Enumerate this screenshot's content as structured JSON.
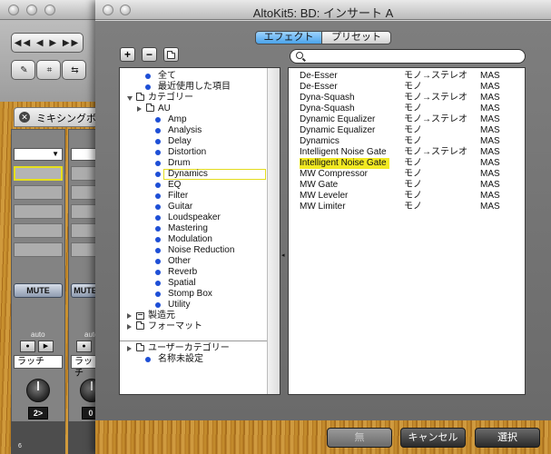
{
  "background_app": {
    "mixer_tab_label": "ミキシングボ",
    "mute_label": "MUTE",
    "auto_label": "auto",
    "latch_label": "ラッチ",
    "pan_left": "2>",
    "pan_right": "0",
    "meter_label": "6"
  },
  "dialog": {
    "title": "AltoKit5: BD: インサート A",
    "tabs": [
      {
        "label": "エフェクト",
        "selected": true
      },
      {
        "label": "プリセット",
        "selected": false
      }
    ],
    "toolbar": {
      "add_symbol": "+",
      "remove_symbol": "−"
    },
    "search": {
      "placeholder": "",
      "value": ""
    }
  },
  "category_tree": [
    {
      "label": "全て",
      "icon": "dot",
      "indent": 1
    },
    {
      "label": "最近使用した項目",
      "icon": "dot",
      "indent": 1
    },
    {
      "label": "カテゴリー",
      "icon": "folder",
      "indent": 0,
      "expanded": true
    },
    {
      "label": "AU",
      "icon": "folder",
      "indent": 1,
      "expanded": false
    },
    {
      "label": "Amp",
      "icon": "dot",
      "indent": 2
    },
    {
      "label": "Analysis",
      "icon": "dot",
      "indent": 2
    },
    {
      "label": "Delay",
      "icon": "dot",
      "indent": 2
    },
    {
      "label": "Distortion",
      "icon": "dot",
      "indent": 2
    },
    {
      "label": "Drum",
      "icon": "dot",
      "indent": 2
    },
    {
      "label": "Dynamics",
      "icon": "dot",
      "indent": 2,
      "selected": true
    },
    {
      "label": "EQ",
      "icon": "dot",
      "indent": 2
    },
    {
      "label": "Filter",
      "icon": "dot",
      "indent": 2
    },
    {
      "label": "Guitar",
      "icon": "dot",
      "indent": 2
    },
    {
      "label": "Loudspeaker",
      "icon": "dot",
      "indent": 2
    },
    {
      "label": "Mastering",
      "icon": "dot",
      "indent": 2
    },
    {
      "label": "Modulation",
      "icon": "dot",
      "indent": 2
    },
    {
      "label": "Noise Reduction",
      "icon": "dot",
      "indent": 2
    },
    {
      "label": "Other",
      "icon": "dot",
      "indent": 2
    },
    {
      "label": "Reverb",
      "icon": "dot",
      "indent": 2
    },
    {
      "label": "Spatial",
      "icon": "dot",
      "indent": 2
    },
    {
      "label": "Stomp Box",
      "icon": "dot",
      "indent": 2
    },
    {
      "label": "Utility",
      "icon": "dot",
      "indent": 2
    },
    {
      "label": "製造元",
      "icon": "list",
      "indent": 0,
      "expanded": false
    },
    {
      "label": "フォーマット",
      "icon": "folder",
      "indent": 0,
      "expanded": false
    }
  ],
  "user_tree": [
    {
      "label": "ユーザーカテゴリー",
      "icon": "folder",
      "indent": 0,
      "expanded": false
    },
    {
      "label": "名称未設定",
      "icon": "dot",
      "indent": 1
    }
  ],
  "effects": [
    {
      "name": "De-Esser",
      "channels": "モノ→ステレオ",
      "format": "MAS"
    },
    {
      "name": "De-Esser",
      "channels": "モノ",
      "format": "MAS"
    },
    {
      "name": "Dyna-Squash",
      "channels": "モノ→ステレオ",
      "format": "MAS"
    },
    {
      "name": "Dyna-Squash",
      "channels": "モノ",
      "format": "MAS"
    },
    {
      "name": "Dynamic Equalizer",
      "channels": "モノ→ステレオ",
      "format": "MAS"
    },
    {
      "name": "Dynamic Equalizer",
      "channels": "モノ",
      "format": "MAS"
    },
    {
      "name": "Dynamics",
      "channels": "モノ",
      "format": "MAS"
    },
    {
      "name": "Intelligent Noise Gate",
      "channels": "モノ→ステレオ",
      "format": "MAS"
    },
    {
      "name": "Intelligent Noise Gate",
      "channels": "モノ",
      "format": "MAS",
      "selected": true
    },
    {
      "name": "MW Compressor",
      "channels": "モノ",
      "format": "MAS"
    },
    {
      "name": "MW Gate",
      "channels": "モノ",
      "format": "MAS"
    },
    {
      "name": "MW Leveler",
      "channels": "モノ",
      "format": "MAS"
    },
    {
      "name": "MW Limiter",
      "channels": "モノ",
      "format": "MAS"
    }
  ],
  "footer": {
    "none_label": "無",
    "cancel_label": "キャンセル",
    "select_label": "選択"
  },
  "colors": {
    "selection_highlight": "#f2ea23",
    "tab_selected": "#4aa3ea",
    "bullet": "#1e4fd6"
  }
}
